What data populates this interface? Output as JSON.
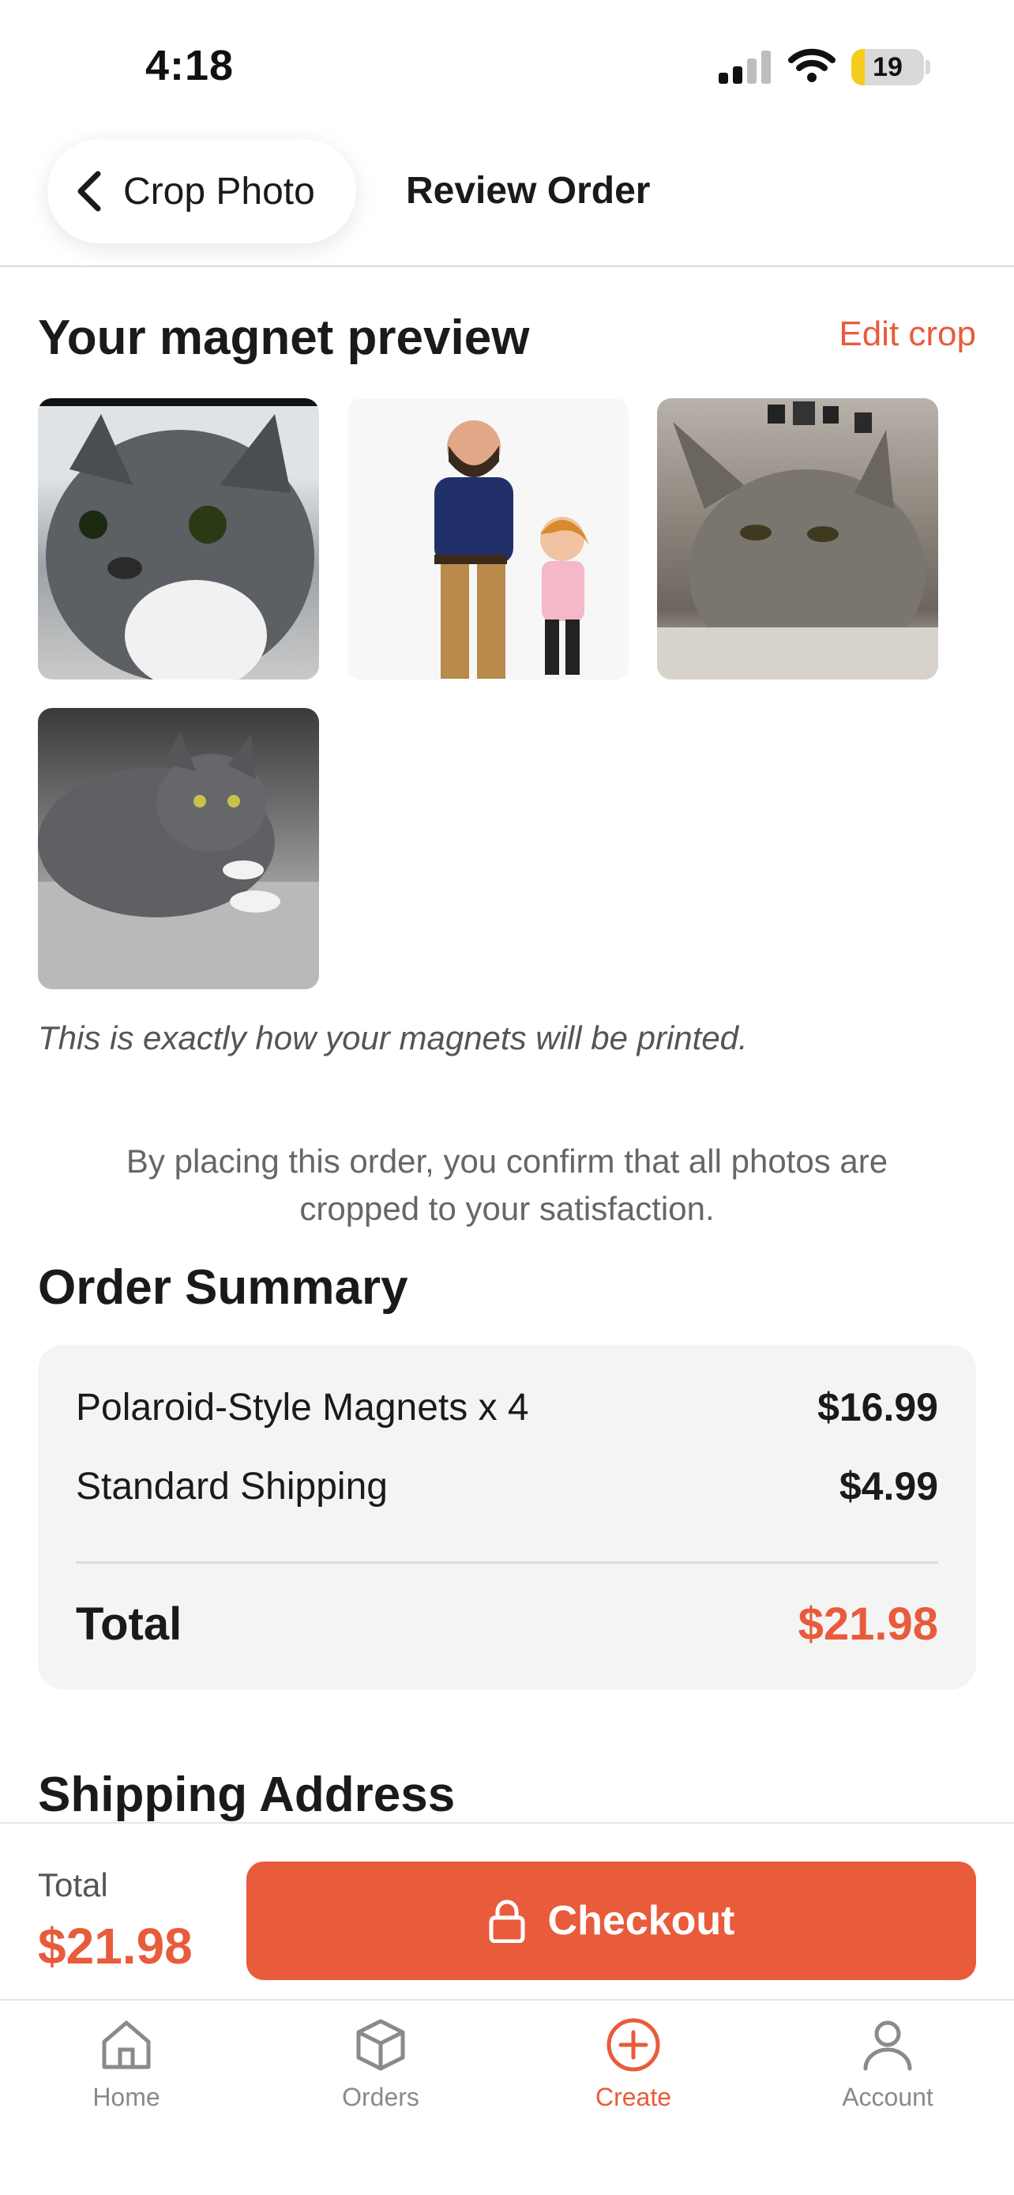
{
  "status_bar": {
    "time": "4:18",
    "battery": "19",
    "battery_level": 0.19
  },
  "header": {
    "back_label": "Crop Photo",
    "title": "Review Order"
  },
  "preview": {
    "heading": "Your magnet preview",
    "edit_link": "Edit crop",
    "photos": [
      "gray-cat-closeup",
      "cartoon-father-and-daughter",
      "tabby-cat",
      "gray-cat-lying"
    ],
    "print_note": "This is exactly how your magnets will be printed.",
    "confirm_note": "By placing this order, you confirm that all photos are cropped to your satisfaction."
  },
  "order_summary": {
    "heading": "Order Summary",
    "items": [
      {
        "label": "Polaroid-Style Magnets x 4",
        "value": "$16.99"
      },
      {
        "label": "Standard Shipping",
        "value": "$4.99"
      }
    ],
    "total_label": "Total",
    "total_value": "$21.98"
  },
  "shipping": {
    "heading": "Shipping Address"
  },
  "checkout_bar": {
    "total_label": "Total",
    "total_value": "$21.98",
    "button_label": "Checkout"
  },
  "tabs": [
    {
      "label": "Home",
      "icon": "home-icon",
      "active": false
    },
    {
      "label": "Orders",
      "icon": "box-icon",
      "active": false
    },
    {
      "label": "Create",
      "icon": "plus-circle-icon",
      "active": true
    },
    {
      "label": "Account",
      "icon": "person-icon",
      "active": false
    }
  ],
  "colors": {
    "accent": "#e85b3b",
    "card_bg": "#f4f4f4",
    "muted_text": "#666666"
  }
}
